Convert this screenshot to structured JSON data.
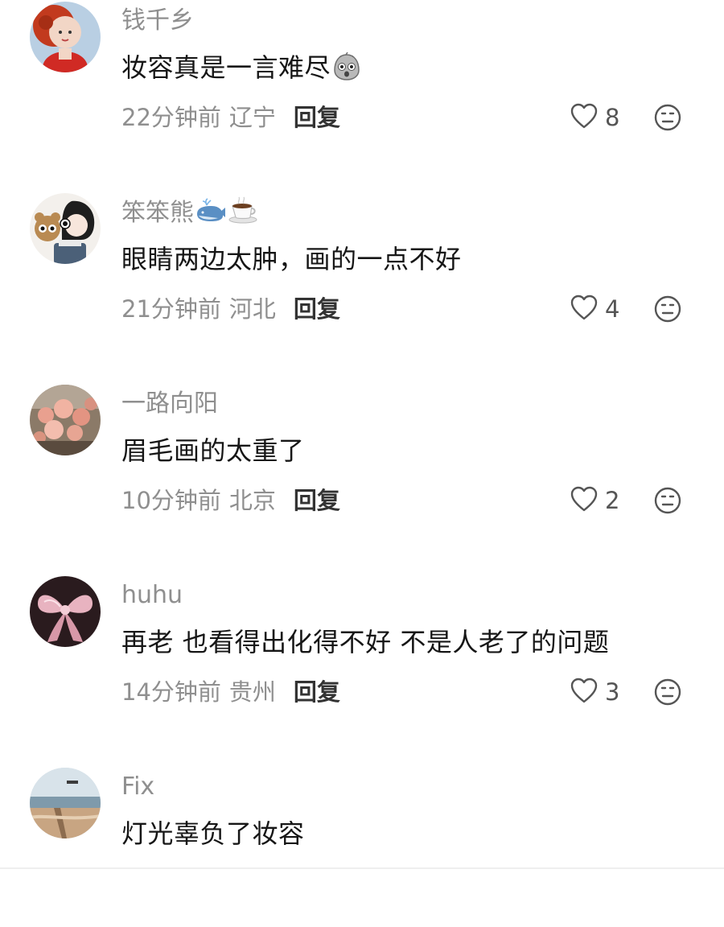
{
  "comments": [
    {
      "username": "钱千乡",
      "text": "妆容真是一言难尽",
      "text_emoji": "shocked-face-emoji",
      "time": "22分钟前",
      "location": "辽宁",
      "reply_label": "回复",
      "likes": "8"
    },
    {
      "username": "笨笨熊",
      "username_emojis": [
        "whale-emoji",
        "coffee-emoji"
      ],
      "text": "眼睛两边太肿，画的一点不好",
      "time": "21分钟前",
      "location": "河北",
      "reply_label": "回复",
      "likes": "4"
    },
    {
      "username": "一路向阳",
      "text": "眉毛画的太重了",
      "time": "10分钟前",
      "location": "北京",
      "reply_label": "回复",
      "likes": "2"
    },
    {
      "username": "huhu",
      "text": "再老 也看得出化得不好 不是人老了的问题",
      "time": "14分钟前",
      "location": "贵州",
      "reply_label": "回复",
      "likes": "3"
    },
    {
      "username": "Fix",
      "text": "灯光辜负了妆容"
    }
  ],
  "colors": {
    "secondary_text": "#8f8f8f",
    "primary_text": "#161616",
    "reply_text": "#333333",
    "icon_stroke": "#555555"
  },
  "icons": {
    "like": "heart-outline-icon",
    "dislike": "neutral-face-icon"
  }
}
